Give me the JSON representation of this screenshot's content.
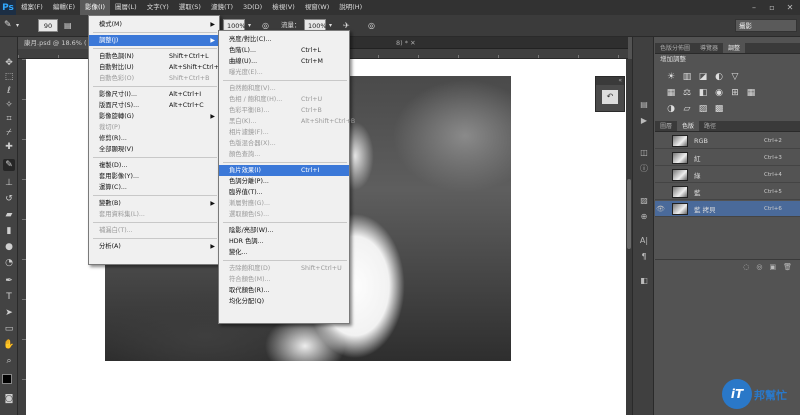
{
  "menubar": {
    "logo": "Ps",
    "items": [
      "檔案(F)",
      "編輯(E)",
      "影像(I)",
      "圖層(L)",
      "文字(Y)",
      "選取(S)",
      "濾鏡(T)",
      "3D(D)",
      "檢視(V)",
      "視窗(W)",
      "說明(H)"
    ],
    "active_index": 2,
    "win_min": "–",
    "win_max": "▫",
    "win_close": "✕"
  },
  "options": {
    "brush_size": "90",
    "opacity_value": "100%",
    "flow_label": "流量：",
    "flow_value": "100%",
    "workspace": "攝影"
  },
  "document": {
    "tab_label": "康月.psd @ 18.6% (",
    "tab_tail": "8) *",
    "tab_close": "✕"
  },
  "image_menu": [
    {
      "label": "模式(M)",
      "arrow": "▶",
      "disabled": false
    },
    {
      "sep": true
    },
    {
      "label": "調整(J)",
      "arrow": "▶",
      "highlight": true
    },
    {
      "sep": true
    },
    {
      "label": "自動色調(N)",
      "shortcut": "Shift+Ctrl+L"
    },
    {
      "label": "自動對比(U)",
      "shortcut": "Alt+Shift+Ctrl+L"
    },
    {
      "label": "自動色彩(O)",
      "shortcut": "Shift+Ctrl+B",
      "disabled": true
    },
    {
      "sep": true
    },
    {
      "label": "影像尺寸(I)...",
      "shortcut": "Alt+Ctrl+I"
    },
    {
      "label": "版面尺寸(S)...",
      "shortcut": "Alt+Ctrl+C"
    },
    {
      "label": "影像旋轉(G)",
      "arrow": "▶"
    },
    {
      "label": "裁切(P)",
      "disabled": true
    },
    {
      "label": "修剪(R)..."
    },
    {
      "label": "全部顯現(V)"
    },
    {
      "sep": true
    },
    {
      "label": "複製(D)..."
    },
    {
      "label": "套用影像(Y)..."
    },
    {
      "label": "運算(C)..."
    },
    {
      "sep": true
    },
    {
      "label": "變數(B)",
      "arrow": "▶"
    },
    {
      "label": "套用資料集(L)...",
      "disabled": true
    },
    {
      "sep": true
    },
    {
      "label": "補漏白(T)...",
      "disabled": true
    },
    {
      "sep": true
    },
    {
      "label": "分析(A)",
      "arrow": "▶"
    }
  ],
  "adjust_menu": [
    {
      "label": "亮度/對比(C)..."
    },
    {
      "label": "色階(L)...",
      "shortcut": "Ctrl+L"
    },
    {
      "label": "曲線(U)...",
      "shortcut": "Ctrl+M"
    },
    {
      "label": "曝光度(E)...",
      "disabled": true
    },
    {
      "sep": true
    },
    {
      "label": "自然飽和度(V)...",
      "disabled": true
    },
    {
      "label": "色相 / 飽和度(H)...",
      "shortcut": "Ctrl+U",
      "disabled": true
    },
    {
      "label": "色彩平衡(B)...",
      "shortcut": "Ctrl+B",
      "disabled": true
    },
    {
      "label": "黑白(K)...",
      "shortcut": "Alt+Shift+Ctrl+B",
      "disabled": true
    },
    {
      "label": "相片濾鏡(F)...",
      "disabled": true
    },
    {
      "label": "色版混合器(X)...",
      "disabled": true
    },
    {
      "label": "顏色查詢...",
      "disabled": true
    },
    {
      "sep": true
    },
    {
      "label": "負片效果(I)",
      "shortcut": "Ctrl+I",
      "highlight": true
    },
    {
      "label": "色調分離(P)..."
    },
    {
      "label": "臨界值(T)..."
    },
    {
      "label": "漸層對應(G)...",
      "disabled": true
    },
    {
      "label": "選取顏色(S)...",
      "disabled": true
    },
    {
      "sep": true
    },
    {
      "label": "陰影/亮部(W)..."
    },
    {
      "label": "HDR 色調..."
    },
    {
      "label": "變化..."
    },
    {
      "sep": true
    },
    {
      "label": "去除飽和度(D)",
      "shortcut": "Shift+Ctrl+U",
      "disabled": true
    },
    {
      "label": "符合顏色(M)...",
      "disabled": true
    },
    {
      "label": "取代顏色(R)..."
    },
    {
      "label": "均化分配(Q)"
    }
  ],
  "right_panel": {
    "top_tabs": [
      "色版分佈圖",
      "導覽器",
      "調整"
    ],
    "adjust_title": "增加調整",
    "icon_rows": [
      [
        "☀",
        "▥",
        "◪",
        "◐",
        "▽"
      ],
      [
        "▦",
        "⚖",
        "◧",
        "◉",
        "⊞",
        "▦"
      ],
      [
        "◑",
        "▱",
        "▨",
        "▩"
      ]
    ],
    "channel_tabs": [
      "圖層",
      "色版",
      "路徑"
    ],
    "channels": [
      {
        "name": "RGB",
        "shortcut": "Ctrl+2"
      },
      {
        "name": "紅",
        "shortcut": "Ctrl+3"
      },
      {
        "name": "綠",
        "shortcut": "Ctrl+4"
      },
      {
        "name": "藍",
        "shortcut": "Ctrl+5"
      },
      {
        "name": "藍 拷貝",
        "shortcut": "Ctrl+6"
      }
    ],
    "footer_icons": [
      "◌",
      "◎",
      "▣",
      "🗑"
    ]
  },
  "watermark": {
    "mark": "iT",
    "text": "邦幫忙"
  }
}
